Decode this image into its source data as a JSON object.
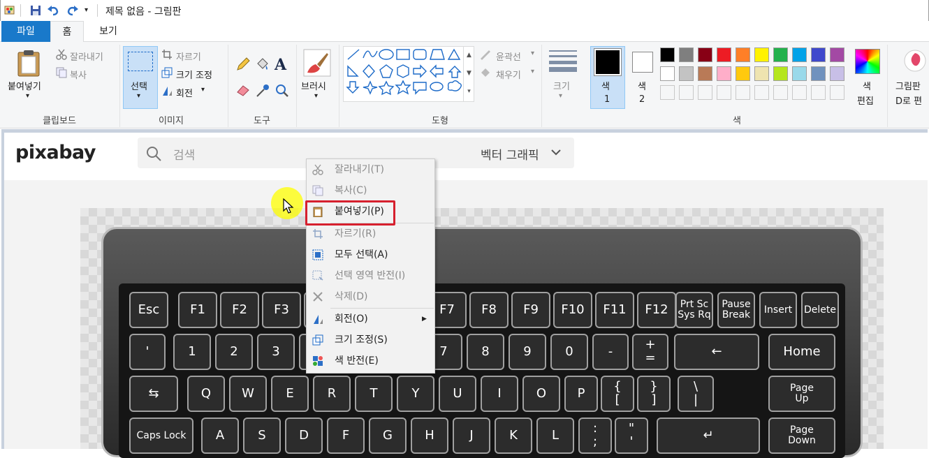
{
  "titlebar": {
    "title": "제목 없음 - 그림판"
  },
  "tabs": {
    "file": "파일",
    "home": "홈",
    "view": "보기"
  },
  "ribbon": {
    "clipboard": {
      "paste": "붙여넣기",
      "cut": "잘라내기",
      "copy": "복사",
      "label": "클립보드"
    },
    "image": {
      "select": "선택",
      "crop": "자르기",
      "resize": "크기 조정",
      "rotate": "회전",
      "label": "이미지"
    },
    "tools": {
      "label": "도구"
    },
    "brushes": {
      "label": "브러시"
    },
    "shapes": {
      "outline": "윤곽선",
      "fill": "채우기",
      "label": "도형"
    },
    "size": {
      "label": "크기"
    },
    "colors": {
      "color1": "색",
      "color1_num": "1",
      "color2": "색",
      "color2_num": "2",
      "edit_1": "색",
      "edit_2": "편집",
      "label": "색",
      "palette_row1": [
        "#000000",
        "#7f7f7f",
        "#880015",
        "#ed1c24",
        "#ff7f27",
        "#fff200",
        "#22b14c",
        "#00a2e8",
        "#3f48cc",
        "#a349a4"
      ],
      "palette_row2": [
        "#ffffff",
        "#c3c3c3",
        "#b97a57",
        "#ffaec9",
        "#ffc90e",
        "#efe4b0",
        "#b5e61d",
        "#99d9ea",
        "#7092be",
        "#c8bfe7"
      ]
    },
    "paint3d": {
      "line1": "그림판",
      "line2": "D로 편"
    }
  },
  "web": {
    "logo": "pixabay",
    "search_placeholder": "검색",
    "filter": "벡터 그래픽"
  },
  "keyboard": {
    "row1": [
      "Esc",
      "F1",
      "F2",
      "F3",
      "",
      "",
      "",
      "F7",
      "F8",
      "F9",
      "F10",
      "F11",
      "F12",
      "Prt Sc\nSys Rq",
      "Pause\nBreak",
      "Insert",
      "Delete"
    ],
    "row2": [
      "'",
      "1",
      "2",
      "3",
      "",
      "",
      "",
      "7",
      "8",
      "9",
      "0",
      "-",
      "+\n=",
      "←",
      "Home"
    ],
    "row3": [
      "⇆",
      "Q",
      "W",
      "E",
      "R",
      "T",
      "Y",
      "U",
      "I",
      "O",
      "P",
      "{\n[",
      "}\n]",
      "\\\n|",
      "Page\nUp"
    ],
    "row4": [
      "Caps Lock",
      "A",
      "S",
      "D",
      "F",
      "G",
      "H",
      "J",
      "K",
      "L",
      ":\n;",
      "\"\n'",
      "↵",
      "Page\nDown"
    ]
  },
  "context_menu": {
    "items": [
      {
        "label": "잘라내기(T)",
        "enabled": false
      },
      {
        "label": "복사(C)",
        "enabled": false
      },
      {
        "label": "붙여넣기(P)",
        "enabled": true
      },
      {
        "label": "자르기(R)",
        "enabled": false
      },
      {
        "label": "모두 선택(A)",
        "enabled": true
      },
      {
        "label": "선택 영역 반전(I)",
        "enabled": false
      },
      {
        "label": "삭제(D)",
        "enabled": false
      },
      {
        "label": "회전(O)",
        "enabled": true
      },
      {
        "label": "크기 조정(S)",
        "enabled": true
      },
      {
        "label": "색 반전(E)",
        "enabled": true
      }
    ]
  },
  "colors": {
    "accent": "#1979ca",
    "highlight": "#d6202e"
  }
}
